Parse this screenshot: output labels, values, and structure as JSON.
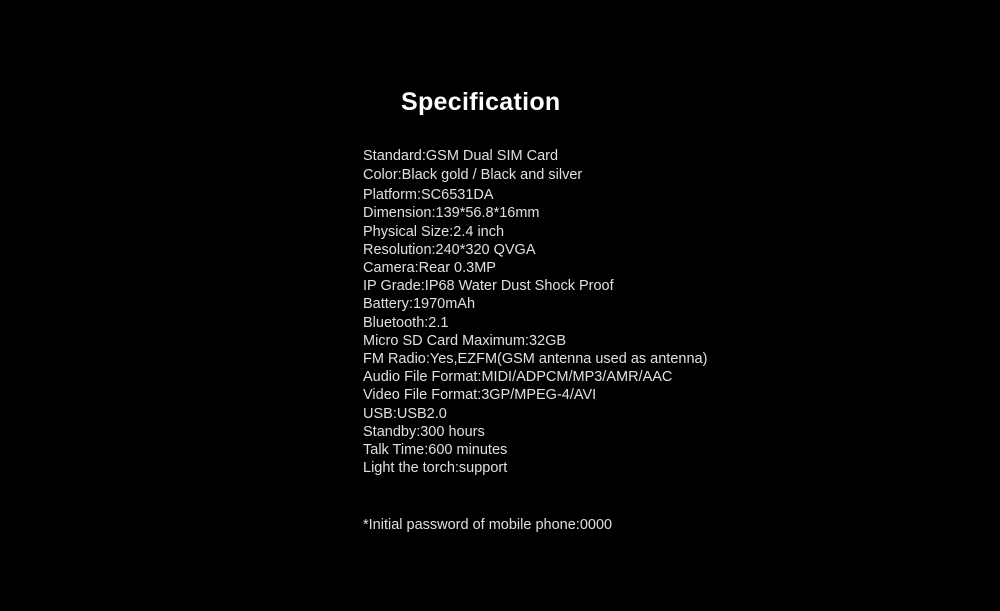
{
  "title": "Specification",
  "specs": [
    "Standard:GSM Dual SIM Card",
    "Color:Black gold / Black and silver",
    "Platform:SC6531DA",
    "Dimension:139*56.8*16mm",
    "Physical Size:2.4 inch",
    "Resolution:240*320 QVGA",
    "Camera:Rear 0.3MP",
    "IP Grade:IP68 Water Dust Shock Proof",
    "Battery:1970mAh",
    "Bluetooth:2.1",
    "Micro SD Card Maximum:32GB",
    "FM Radio:Yes,EZFM(GSM antenna used as antenna)",
    "Audio File Format:MIDI/ADPCM/MP3/AMR/AAC",
    "Video File Format:3GP/MPEG-4/AVI",
    "USB:USB2.0",
    "Standby:300 hours",
    "Talk Time:600 minutes",
    "Light the torch:support"
  ],
  "note": "*Initial password of mobile phone:0000"
}
